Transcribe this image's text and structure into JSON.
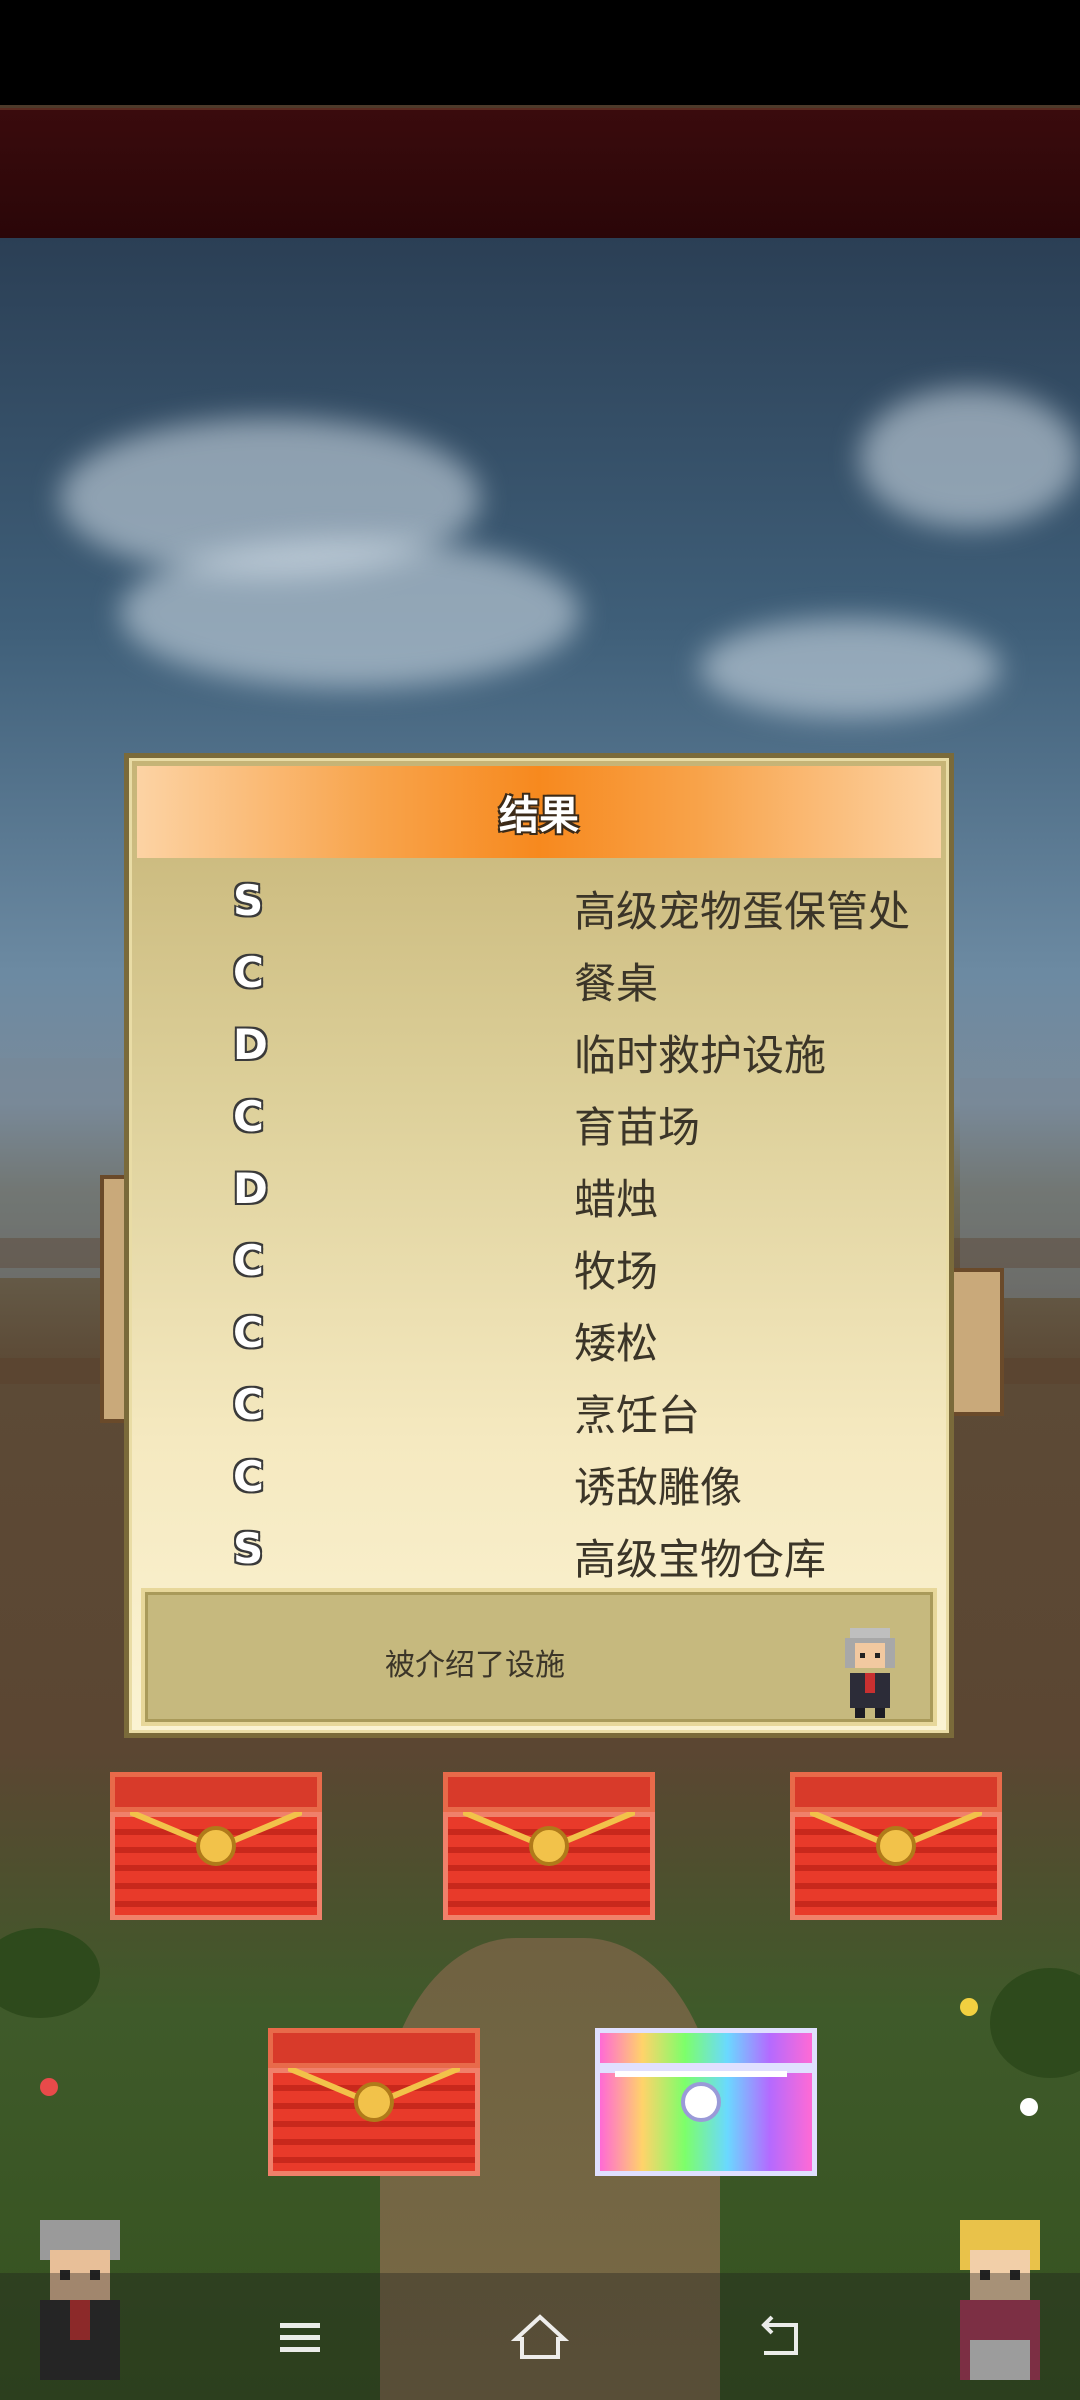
{
  "dialog": {
    "title": "结果",
    "results": [
      {
        "grade": "S",
        "facility": "高级宠物蛋保管处"
      },
      {
        "grade": "C",
        "facility": "餐桌"
      },
      {
        "grade": "D",
        "facility": "临时救护设施"
      },
      {
        "grade": "C",
        "facility": "育苗场"
      },
      {
        "grade": "D",
        "facility": "蜡烛"
      },
      {
        "grade": "C",
        "facility": "牧场"
      },
      {
        "grade": "C",
        "facility": "矮松"
      },
      {
        "grade": "C",
        "facility": "烹饪台"
      },
      {
        "grade": "C",
        "facility": "诱敌雕像"
      },
      {
        "grade": "S",
        "facility": "高级宝物仓库"
      }
    ],
    "message": "被介绍了设施"
  },
  "chests": [
    {
      "kind": "red"
    },
    {
      "kind": "red"
    },
    {
      "kind": "red"
    },
    {
      "kind": "red"
    },
    {
      "kind": "rainbow"
    }
  ],
  "nav": {
    "menu_icon": "menu-icon",
    "home_icon": "home-icon",
    "back_icon": "back-icon"
  },
  "colors": {
    "header_orange": "#f7891e",
    "dialog_bg": "#f5e9c0",
    "chest_red": "#e83a2a"
  }
}
